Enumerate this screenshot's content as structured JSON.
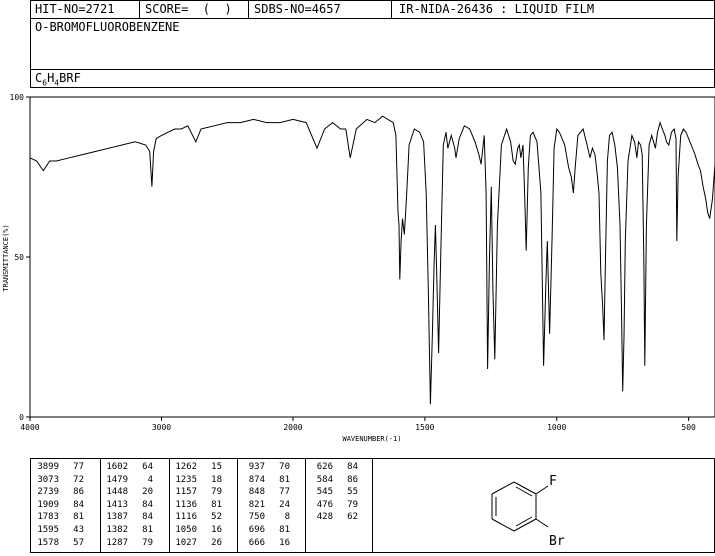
{
  "header": {
    "hit": "HIT-NO=2721",
    "score": "SCORE=  (  )",
    "sdbs": "SDBS-NO=4657",
    "ir": "IR-NIDA-26436 : LIQUID FILM"
  },
  "compound_name": "O-BROMOFLUOROBENZENE",
  "formula": {
    "c": "C",
    "c_sub": "6",
    "h": "H",
    "h_sub": "4",
    "rest": "BRF"
  },
  "structure": {
    "f_label": "F",
    "br_label": "Br"
  },
  "peak_table": [
    [
      [
        "3899",
        "77"
      ],
      [
        "3073",
        "72"
      ],
      [
        "2739",
        "86"
      ],
      [
        "1909",
        "84"
      ],
      [
        "1783",
        "81"
      ],
      [
        "1595",
        "43"
      ],
      [
        "1578",
        "57"
      ]
    ],
    [
      [
        "1602",
        "64"
      ],
      [
        "1479",
        "4"
      ],
      [
        "1448",
        "20"
      ],
      [
        "1413",
        "84"
      ],
      [
        "1387",
        "84"
      ],
      [
        "1382",
        "81"
      ],
      [
        "1287",
        "79"
      ]
    ],
    [
      [
        "1262",
        "15"
      ],
      [
        "1235",
        "18"
      ],
      [
        "1157",
        "79"
      ],
      [
        "1136",
        "81"
      ],
      [
        "1116",
        "52"
      ],
      [
        "1050",
        "16"
      ],
      [
        "1027",
        "26"
      ]
    ],
    [
      [
        "937",
        "70"
      ],
      [
        "874",
        "81"
      ],
      [
        "848",
        "77"
      ],
      [
        "821",
        "24"
      ],
      [
        "750",
        "8"
      ],
      [
        "696",
        "81"
      ],
      [
        "666",
        "16"
      ]
    ],
    [
      [
        "626",
        "84"
      ],
      [
        "584",
        "86"
      ],
      [
        "545",
        "55"
      ],
      [
        "476",
        "79"
      ],
      [
        "428",
        "62"
      ]
    ]
  ],
  "chart_data": {
    "type": "line",
    "xlabel": "WAVENUMBER(-1)",
    "ylabel": "TRANSMITTANCE(%)",
    "xlim": [
      4000,
      400
    ],
    "ylim": [
      0,
      100
    ],
    "x_ticks": [
      4000,
      3000,
      2000,
      1500,
      1000,
      500
    ],
    "y_ticks": [
      0,
      50,
      100
    ],
    "grid": false,
    "series": [
      {
        "x": [
          4000,
          3950,
          3899,
          3850,
          3800,
          3700,
          3600,
          3500,
          3400,
          3300,
          3200,
          3120,
          3090,
          3073,
          3060,
          3040,
          3000,
          2950,
          2900,
          2850,
          2800,
          2739,
          2700,
          2600,
          2500,
          2400,
          2300,
          2200,
          2100,
          2000,
          1950,
          1909,
          1880,
          1850,
          1820,
          1800,
          1783,
          1760,
          1720,
          1690,
          1660,
          1640,
          1620,
          1610,
          1602,
          1598,
          1595,
          1590,
          1585,
          1578,
          1570,
          1560,
          1540,
          1520,
          1505,
          1495,
          1487,
          1479,
          1472,
          1465,
          1460,
          1455,
          1448,
          1440,
          1430,
          1420,
          1413,
          1400,
          1387,
          1382,
          1370,
          1350,
          1330,
          1310,
          1295,
          1287,
          1275,
          1268,
          1262,
          1255,
          1248,
          1242,
          1235,
          1225,
          1210,
          1190,
          1175,
          1165,
          1157,
          1148,
          1142,
          1136,
          1128,
          1122,
          1116,
          1108,
          1100,
          1090,
          1075,
          1060,
          1050,
          1042,
          1036,
          1027,
          1018,
          1010,
          1000,
          990,
          970,
          955,
          945,
          937,
          930,
          920,
          900,
          885,
          874,
          865,
          855,
          848,
          840,
          833,
          826,
          821,
          815,
          808,
          800,
          790,
          780,
          770,
          760,
          755,
          750,
          745,
          740,
          730,
          715,
          705,
          696,
          690,
          682,
          676,
          670,
          666,
          660,
          650,
          640,
          633,
          626,
          618,
          608,
          600,
          590,
          584,
          575,
          565,
          555,
          548,
          545,
          540,
          530,
          520,
          510,
          500,
          490,
          476,
          465,
          455,
          445,
          435,
          428,
          420,
          410,
          400
        ],
        "y": [
          81,
          80,
          77,
          80,
          80,
          81,
          82,
          83,
          84,
          85,
          86,
          85,
          83,
          72,
          83,
          87,
          88,
          89,
          90,
          90,
          91,
          86,
          90,
          91,
          92,
          92,
          93,
          92,
          92,
          93,
          92,
          84,
          90,
          92,
          90,
          90,
          81,
          90,
          93,
          92,
          94,
          93,
          92,
          88,
          64,
          60,
          43,
          55,
          62,
          57,
          68,
          85,
          90,
          89,
          86,
          70,
          40,
          4,
          25,
          48,
          60,
          45,
          20,
          50,
          85,
          89,
          84,
          88,
          84,
          81,
          87,
          91,
          90,
          86,
          82,
          79,
          88,
          70,
          15,
          50,
          72,
          40,
          18,
          60,
          85,
          90,
          86,
          80,
          79,
          84,
          85,
          81,
          85,
          70,
          52,
          78,
          88,
          89,
          86,
          70,
          16,
          40,
          55,
          26,
          55,
          84,
          90,
          89,
          85,
          78,
          75,
          70,
          78,
          88,
          90,
          85,
          81,
          84,
          82,
          77,
          70,
          45,
          35,
          24,
          50,
          80,
          88,
          89,
          85,
          78,
          60,
          35,
          8,
          25,
          55,
          80,
          88,
          86,
          81,
          86,
          85,
          82,
          50,
          16,
          60,
          85,
          88,
          86,
          84,
          89,
          92,
          90,
          88,
          86,
          85,
          89,
          90,
          87,
          55,
          75,
          88,
          90,
          89,
          87,
          85,
          82,
          79,
          77,
          72,
          68,
          64,
          62,
          68,
          79
        ]
      }
    ]
  }
}
